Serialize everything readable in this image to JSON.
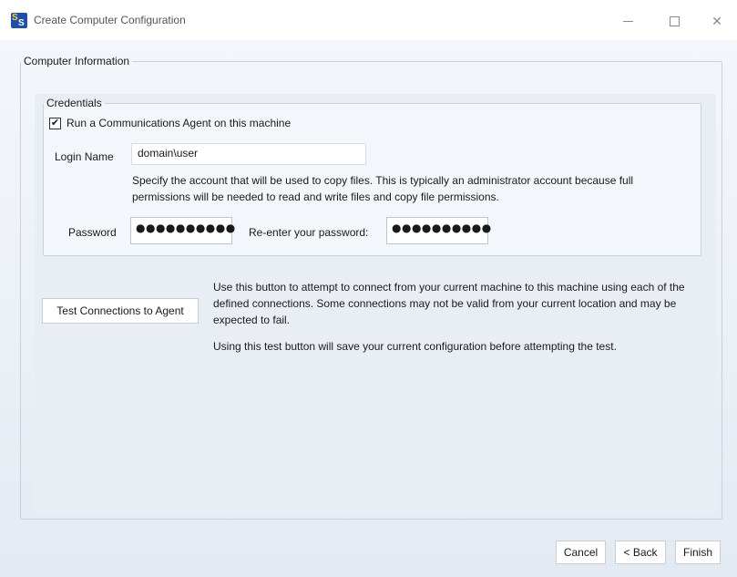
{
  "window": {
    "title": "Create Computer Configuration",
    "icon": "app-logo-icon"
  },
  "computer_info": {
    "legend": "Computer Information"
  },
  "credentials": {
    "legend": "Credentials",
    "run_agent_checkbox": {
      "label": "Run a Communications Agent on this machine",
      "checked": true
    },
    "login_name_label": "Login Name",
    "login_name_value": "domain\\user",
    "login_hint": "Specify the account that will be used to copy files. This is typically an administrator account because full permissions will be needed to read and write files and copy file permissions.",
    "password_label": "Password",
    "password_value": "●●●●●●●●●●",
    "reenter_label": "Re-enter your password:",
    "reenter_value": "●●●●●●●●●●"
  },
  "test": {
    "button_label": "Test Connections to Agent",
    "description1": "Use this button to attempt to connect from your current machine to this machine using each of the defined connections. Some connections may not be valid from your current location and may be expected to fail.",
    "description2": "Using this test button will save your current configuration before attempting the test."
  },
  "footer": {
    "cancel_label": "Cancel",
    "back_label": "< Back",
    "finish_label": "Finish"
  }
}
